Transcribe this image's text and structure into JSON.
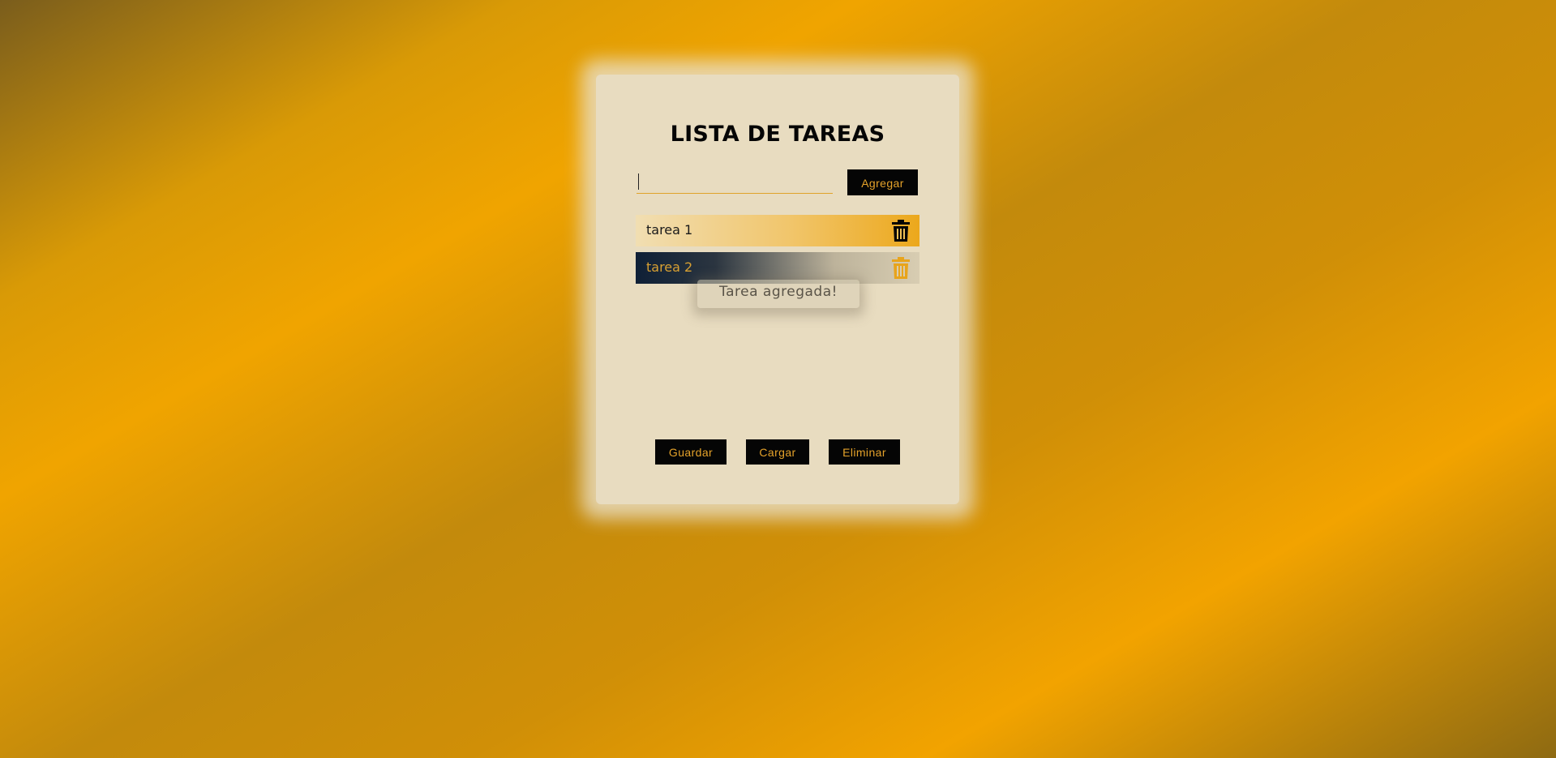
{
  "app": {
    "title": "LISTA DE TAREAS"
  },
  "input": {
    "value": "",
    "placeholder": ""
  },
  "buttons": {
    "add_label": "Agregar",
    "save_label": "Guardar",
    "load_label": "Cargar",
    "clear_label": "Eliminar"
  },
  "tasks": [
    {
      "label": "tarea 1",
      "icon": "trash-icon",
      "icon_color": "#050505"
    },
    {
      "label": "tarea 2",
      "icon": "trash-icon",
      "icon_color": "#e8a41c"
    }
  ],
  "toast": {
    "message": "Tarea agregada!"
  },
  "colors": {
    "accent": "#f0a400",
    "button_bg": "#050505",
    "button_text": "#e5a22a",
    "card_bg": "#e8dcc0"
  }
}
